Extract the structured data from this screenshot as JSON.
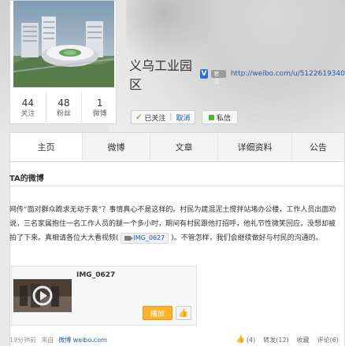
{
  "profile": {
    "name": "义乌工业园区",
    "verified": "V",
    "gov_tag": "官方",
    "url": "http://weibo.com/u/5122619340",
    "stats": [
      {
        "num": "44",
        "label": "关注"
      },
      {
        "num": "48",
        "label": "粉丝"
      },
      {
        "num": "1",
        "label": "微博"
      }
    ],
    "follow_label": "已关注",
    "cancel_label": "取消",
    "message_label": "私信"
  },
  "tabs": [
    {
      "label": "主页"
    },
    {
      "label": "微博"
    },
    {
      "label": "文章"
    },
    {
      "label": "详细资料"
    },
    {
      "label": "公告"
    }
  ],
  "panel": {
    "title": "TA的微博"
  },
  "post": {
    "text_before": "网传“面对群众跪求无动于衷”？事情真心不是这样的。村民为建混泥土搅拌站堵办公楼，工作人员出面劝说，三名家属抱住一名工作人员的腿一个多小时，期间有村民跟他打招呼，他礼节性微笑回应，没想却被拍了下来。真相请各位大大看视频(",
    "video_chip": "IMG_0627",
    "text_after": ")。不管怎样，我们会继续做好与村民的沟通的。",
    "media_title": "IMG_0627",
    "play_label": "播放",
    "time": "19分钟前",
    "source_prefix": "来自",
    "source": "微博 weibo.com",
    "like_count": "(4)",
    "repost": "转发(12)",
    "favorite": "收藏",
    "comment": "评论(6)"
  },
  "colors": {
    "link": "#1d5aa8",
    "accent": "#ffb12b",
    "verified": "#2c6fd3"
  }
}
